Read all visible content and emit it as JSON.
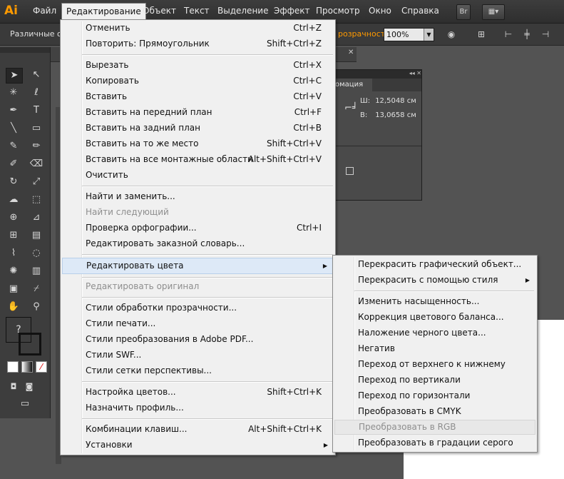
{
  "app": {
    "logo": "Ai"
  },
  "menubar": {
    "items": [
      "Файл",
      "Редактирование",
      "Объект",
      "Текст",
      "Выделение",
      "Эффект",
      "Просмотр",
      "Окно",
      "Справка"
    ],
    "active_index": 1,
    "bridge_label": "Br"
  },
  "controlbar": {
    "selection_label": "Различные объ",
    "opacity_label": "розрачность:",
    "opacity_value": "100%"
  },
  "info_panel": {
    "tab_label": "омация",
    "width_label": "Ш:",
    "width_value": "12,5048 см",
    "height_label": "В:",
    "height_value": "13,0658 см"
  },
  "toolbox": {
    "fill_placeholder": "?"
  },
  "edit_menu": {
    "groups": [
      [
        {
          "label": "Отменить",
          "shortcut": "Ctrl+Z"
        },
        {
          "label": "Повторить: Прямоугольник",
          "shortcut": "Shift+Ctrl+Z"
        }
      ],
      [
        {
          "label": "Вырезать",
          "shortcut": "Ctrl+X"
        },
        {
          "label": "Копировать",
          "shortcut": "Ctrl+C"
        },
        {
          "label": "Вставить",
          "shortcut": "Ctrl+V"
        },
        {
          "label": "Вставить на передний план",
          "shortcut": "Ctrl+F"
        },
        {
          "label": "Вставить на задний план",
          "shortcut": "Ctrl+B"
        },
        {
          "label": "Вставить на то же место",
          "shortcut": "Shift+Ctrl+V"
        },
        {
          "label": "Вставить на все монтажные области",
          "shortcut": "Alt+Shift+Ctrl+V"
        },
        {
          "label": "Очистить",
          "shortcut": ""
        }
      ],
      [
        {
          "label": "Найти и заменить...",
          "shortcut": ""
        },
        {
          "label": "Найти следующий",
          "shortcut": "",
          "disabled": true
        },
        {
          "label": "Проверка орфографии...",
          "shortcut": "Ctrl+I"
        },
        {
          "label": "Редактировать заказной словарь...",
          "shortcut": ""
        }
      ],
      [
        {
          "label": "Редактировать цвета",
          "shortcut": "",
          "submenu": true,
          "highlighted": true
        }
      ],
      [
        {
          "label": "Редактировать оригинал",
          "shortcut": "",
          "disabled": true
        }
      ],
      [
        {
          "label": "Стили обработки прозрачности...",
          "shortcut": ""
        },
        {
          "label": "Стили печати...",
          "shortcut": ""
        },
        {
          "label": "Стили преобразования в Adobe PDF...",
          "shortcut": ""
        },
        {
          "label": "Стили SWF...",
          "shortcut": ""
        },
        {
          "label": "Стили сетки перспективы...",
          "shortcut": ""
        }
      ],
      [
        {
          "label": "Настройка цветов...",
          "shortcut": "Shift+Ctrl+K"
        },
        {
          "label": "Назначить профиль...",
          "shortcut": ""
        }
      ],
      [
        {
          "label": "Комбинации клавиш...",
          "shortcut": "Alt+Shift+Ctrl+K"
        },
        {
          "label": "Установки",
          "shortcut": "",
          "submenu": true
        }
      ]
    ]
  },
  "color_submenu": {
    "groups": [
      [
        {
          "label": "Перекрасить графический объект..."
        },
        {
          "label": "Перекрасить с помощью стиля",
          "submenu": true
        }
      ],
      [
        {
          "label": "Изменить насыщенность..."
        },
        {
          "label": "Коррекция цветового баланса..."
        },
        {
          "label": "Наложение черного цвета..."
        },
        {
          "label": "Негатив"
        },
        {
          "label": "Переход от верхнего к нижнему"
        },
        {
          "label": "Переход по вертикали"
        },
        {
          "label": "Переход по горизонтали"
        },
        {
          "label": "Преобразовать в CMYK"
        },
        {
          "label": "Преобразовать в RGB",
          "disabled": true,
          "hovered": true
        },
        {
          "label": "Преобразовать в градации серого"
        }
      ]
    ]
  },
  "colors": {
    "accent": "#ff9a00",
    "menu_bg": "#f0f0f0",
    "ui_dark": "#3a3a3a",
    "highlight": "#dde9f7"
  }
}
